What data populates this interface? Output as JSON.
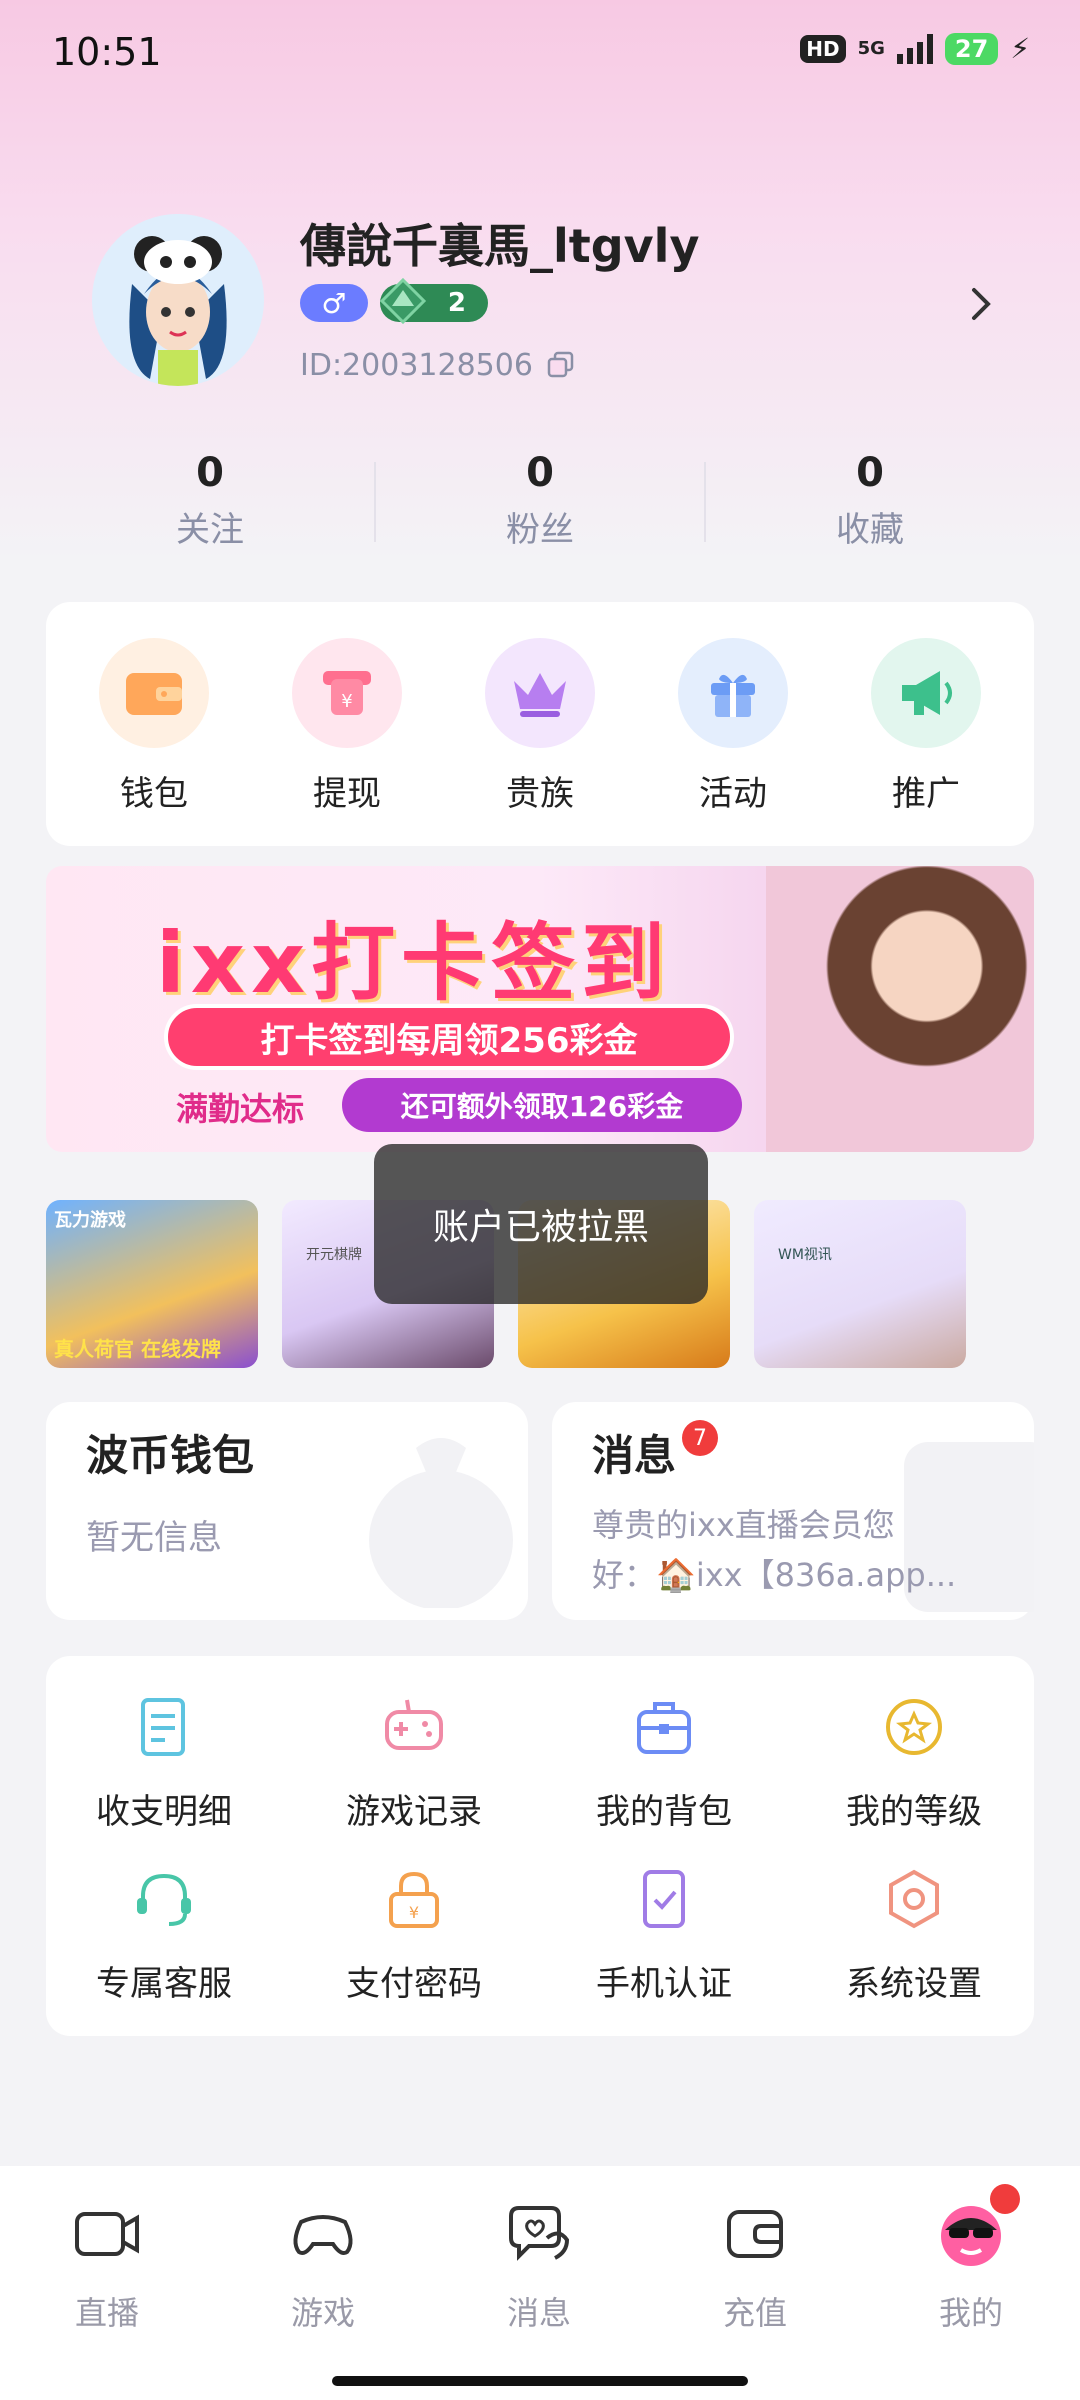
{
  "status_bar": {
    "time": "10:51",
    "hd": "HD",
    "network": "5G",
    "battery": "27"
  },
  "profile": {
    "username": "傳說千裏馬_ltgvly",
    "gender_symbol": "♂",
    "level": "2",
    "id_text": "ID:2003128506"
  },
  "stats": [
    {
      "value": "0",
      "label": "关注"
    },
    {
      "value": "0",
      "label": "粉丝"
    },
    {
      "value": "0",
      "label": "收藏"
    }
  ],
  "quick_actions": [
    {
      "label": "钱包",
      "icon": "wallet-icon",
      "color": "#ffa75a"
    },
    {
      "label": "提现",
      "icon": "withdraw-icon",
      "color": "#ff6f8f"
    },
    {
      "label": "贵族",
      "icon": "crown-icon",
      "color": "#a96cf0"
    },
    {
      "label": "活动",
      "icon": "gift-icon",
      "color": "#6c9cf5"
    },
    {
      "label": "推广",
      "icon": "megaphone-icon",
      "color": "#3dc08c"
    }
  ],
  "banner": {
    "title": "ixx打卡签到",
    "line1": "打卡签到每周领256彩金",
    "tag": "满勤达标",
    "line2": "还可额外领取126彩金"
  },
  "game_tiles": [
    {
      "brand": "瓦力游戏",
      "caption": "真人荷官 在线发牌"
    },
    {
      "brand": "开元棋牌",
      "caption": ""
    },
    {
      "brand": "",
      "caption": ""
    },
    {
      "brand": "WM视讯",
      "caption": ""
    }
  ],
  "toast": "账户已被拉黑",
  "wallet_card": {
    "title": "波币钱包",
    "subtitle": "暂无信息"
  },
  "message_card": {
    "title": "消息",
    "badge": "7",
    "preview_line1": "尊贵的ixx直播会员您",
    "preview_line2": "好：🏠ixx【836a.app..."
  },
  "menu": [
    {
      "label": "收支明细",
      "icon": "ledger-icon",
      "color": "#5ec4e0"
    },
    {
      "label": "游戏记录",
      "icon": "gamepad-icon",
      "color": "#f08aa6"
    },
    {
      "label": "我的背包",
      "icon": "backpack-icon",
      "color": "#6c8cf5"
    },
    {
      "label": "我的等级",
      "icon": "level-star-icon",
      "color": "#e8b830"
    },
    {
      "label": "专属客服",
      "icon": "headset-icon",
      "color": "#48c6a8"
    },
    {
      "label": "支付密码",
      "icon": "lock-icon",
      "color": "#f4a14e"
    },
    {
      "label": "手机认证",
      "icon": "phone-check-icon",
      "color": "#a07ce6"
    },
    {
      "label": "系统设置",
      "icon": "settings-hex-icon",
      "color": "#f09480"
    }
  ],
  "bottom_nav": [
    {
      "label": "直播",
      "icon": "camera-icon"
    },
    {
      "label": "游戏",
      "icon": "gamepad-icon"
    },
    {
      "label": "消息",
      "icon": "chat-heart-icon"
    },
    {
      "label": "充值",
      "icon": "wallet-card-icon"
    },
    {
      "label": "我的",
      "icon": "avatar-icon"
    }
  ]
}
